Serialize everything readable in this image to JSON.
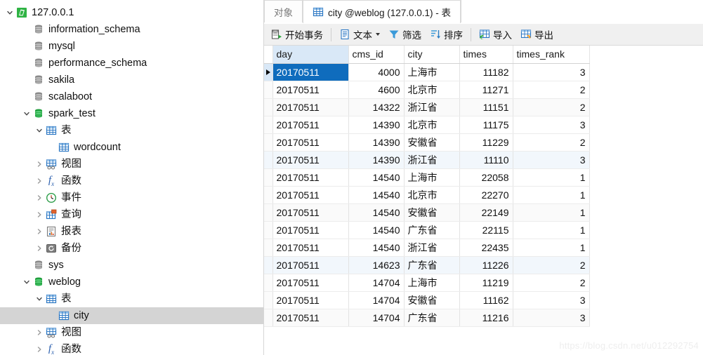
{
  "sidebar": {
    "items": [
      {
        "label": "127.0.0.1",
        "level": 0,
        "twisty": "down",
        "icon": "navicat-connection-icon",
        "selected": false
      },
      {
        "label": "information_schema",
        "level": 1,
        "twisty": "none",
        "icon": "database-gray-icon",
        "selected": false
      },
      {
        "label": "mysql",
        "level": 1,
        "twisty": "none",
        "icon": "database-gray-icon",
        "selected": false
      },
      {
        "label": "performance_schema",
        "level": 1,
        "twisty": "none",
        "icon": "database-gray-icon",
        "selected": false
      },
      {
        "label": "sakila",
        "level": 1,
        "twisty": "none",
        "icon": "database-gray-icon",
        "selected": false
      },
      {
        "label": "scalaboot",
        "level": 1,
        "twisty": "none",
        "icon": "database-gray-icon",
        "selected": false
      },
      {
        "label": "spark_test",
        "level": 1,
        "twisty": "down",
        "icon": "database-green-icon",
        "selected": false
      },
      {
        "label": "表",
        "level": 2,
        "twisty": "down",
        "icon": "table-icon",
        "selected": false
      },
      {
        "label": "wordcount",
        "level": 3,
        "twisty": "none",
        "icon": "table-icon",
        "selected": false
      },
      {
        "label": "视图",
        "level": 2,
        "twisty": "right",
        "icon": "view-icon",
        "selected": false
      },
      {
        "label": "函数",
        "level": 2,
        "twisty": "right",
        "icon": "function-icon",
        "selected": false
      },
      {
        "label": "事件",
        "level": 2,
        "twisty": "right",
        "icon": "event-clock-icon",
        "selected": false
      },
      {
        "label": "查询",
        "level": 2,
        "twisty": "right",
        "icon": "query-icon",
        "selected": false
      },
      {
        "label": "报表",
        "level": 2,
        "twisty": "right",
        "icon": "report-icon",
        "selected": false
      },
      {
        "label": "备份",
        "level": 2,
        "twisty": "right",
        "icon": "backup-icon",
        "selected": false
      },
      {
        "label": "sys",
        "level": 1,
        "twisty": "none",
        "icon": "database-gray-icon",
        "selected": false
      },
      {
        "label": "weblog",
        "level": 1,
        "twisty": "down",
        "icon": "database-green-icon",
        "selected": false
      },
      {
        "label": "表",
        "level": 2,
        "twisty": "down",
        "icon": "table-icon",
        "selected": false
      },
      {
        "label": "city",
        "level": 3,
        "twisty": "none",
        "icon": "table-icon",
        "selected": true
      },
      {
        "label": "视图",
        "level": 2,
        "twisty": "right",
        "icon": "view-icon",
        "selected": false
      },
      {
        "label": "函数",
        "level": 2,
        "twisty": "right",
        "icon": "function-icon",
        "selected": false
      }
    ]
  },
  "tabs": [
    {
      "label": "对象",
      "active": false,
      "icon": "none"
    },
    {
      "label": "city @weblog (127.0.0.1) - 表",
      "active": true,
      "icon": "table-icon"
    }
  ],
  "toolbar": {
    "buttons": [
      {
        "label": "开始事务",
        "icon": "begin-transaction-icon",
        "caret": false
      },
      {
        "label": "文本",
        "icon": "text-document-icon",
        "caret": true
      },
      {
        "label": "筛选",
        "icon": "filter-funnel-icon",
        "caret": false
      },
      {
        "label": "排序",
        "icon": "sort-descending-icon",
        "caret": false
      },
      {
        "label": "导入",
        "icon": "import-icon",
        "caret": false
      },
      {
        "label": "导出",
        "icon": "export-icon",
        "caret": false
      }
    ]
  },
  "grid": {
    "columns": [
      {
        "key": "day",
        "label": "day",
        "align": "txt",
        "width_class": "colw-day",
        "highlighted": true
      },
      {
        "key": "cms_id",
        "label": "cms_id",
        "align": "num",
        "width_class": "colw-cms",
        "highlighted": false
      },
      {
        "key": "city",
        "label": "city",
        "align": "txt",
        "width_class": "colw-city",
        "highlighted": false
      },
      {
        "key": "times",
        "label": "times",
        "align": "num",
        "width_class": "colw-times",
        "highlighted": false
      },
      {
        "key": "times_rank",
        "label": "times_rank",
        "align": "num",
        "width_class": "colw-rank",
        "highlighted": false
      }
    ],
    "rows": [
      {
        "day": "20170511",
        "cms_id": "4000",
        "city": "上海市",
        "times": "11182",
        "times_rank": "3",
        "selected": true,
        "band": ""
      },
      {
        "day": "20170511",
        "cms_id": "4600",
        "city": "北京市",
        "times": "11271",
        "times_rank": "2",
        "selected": false,
        "band": ""
      },
      {
        "day": "20170511",
        "cms_id": "14322",
        "city": "浙江省",
        "times": "11151",
        "times_rank": "2",
        "selected": false,
        "band": "alt"
      },
      {
        "day": "20170511",
        "cms_id": "14390",
        "city": "北京市",
        "times": "11175",
        "times_rank": "3",
        "selected": false,
        "band": ""
      },
      {
        "day": "20170511",
        "cms_id": "14390",
        "city": "安徽省",
        "times": "11229",
        "times_rank": "2",
        "selected": false,
        "band": ""
      },
      {
        "day": "20170511",
        "cms_id": "14390",
        "city": "浙江省",
        "times": "11110",
        "times_rank": "3",
        "selected": false,
        "band": "alt2"
      },
      {
        "day": "20170511",
        "cms_id": "14540",
        "city": "上海市",
        "times": "22058",
        "times_rank": "1",
        "selected": false,
        "band": ""
      },
      {
        "day": "20170511",
        "cms_id": "14540",
        "city": "北京市",
        "times": "22270",
        "times_rank": "1",
        "selected": false,
        "band": ""
      },
      {
        "day": "20170511",
        "cms_id": "14540",
        "city": "安徽省",
        "times": "22149",
        "times_rank": "1",
        "selected": false,
        "band": "alt"
      },
      {
        "day": "20170511",
        "cms_id": "14540",
        "city": "广东省",
        "times": "22115",
        "times_rank": "1",
        "selected": false,
        "band": ""
      },
      {
        "day": "20170511",
        "cms_id": "14540",
        "city": "浙江省",
        "times": "22435",
        "times_rank": "1",
        "selected": false,
        "band": ""
      },
      {
        "day": "20170511",
        "cms_id": "14623",
        "city": "广东省",
        "times": "11226",
        "times_rank": "2",
        "selected": false,
        "band": "alt2"
      },
      {
        "day": "20170511",
        "cms_id": "14704",
        "city": "上海市",
        "times": "11219",
        "times_rank": "2",
        "selected": false,
        "band": ""
      },
      {
        "day": "20170511",
        "cms_id": "14704",
        "city": "安徽省",
        "times": "11162",
        "times_rank": "3",
        "selected": false,
        "band": ""
      },
      {
        "day": "20170511",
        "cms_id": "14704",
        "city": "广东省",
        "times": "11216",
        "times_rank": "3",
        "selected": false,
        "band": "alt"
      }
    ]
  },
  "watermark": "https://blog.csdn.net/u012292754",
  "colors": {
    "selection_blue": "#0f6cbd",
    "header_highlight": "#d9e8f7",
    "tree_selection": "#d4d4d4",
    "chrome_gray": "#f0f0f0"
  }
}
